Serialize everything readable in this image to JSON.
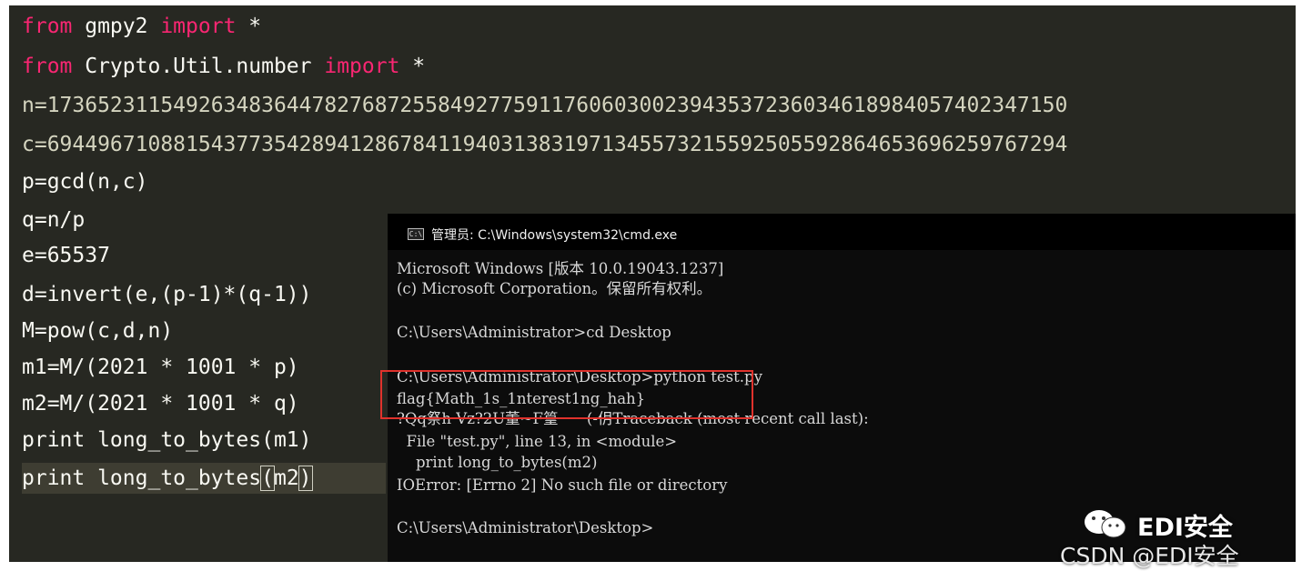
{
  "editor": {
    "lines": [
      {
        "a": "from",
        "b": " gmpy2 ",
        "c": "import",
        "d": " *"
      },
      {
        "a": "from",
        "b": " Crypto.Util.number ",
        "c": "import",
        "d": " *"
      },
      {
        "text": "n=173652311549263483644782768725584927759117606030023943537236034618984057402347150"
      },
      {
        "text": "c=694496710881543773542894128678411940313831971345573215592505592864653696259767294"
      },
      {
        "text": "p=gcd(n,c)"
      },
      {
        "text": "q=n/p"
      },
      {
        "text": "e=65537"
      },
      {
        "text": "d=invert(e,(p-1)*(q-1))"
      },
      {
        "text": "M=pow(c,d,n)"
      },
      {
        "text": "m1=M/(2021 * 1001 * p)"
      },
      {
        "text": "m2=M/(2021 * 1001 * q)"
      },
      {
        "text": "print long_to_bytes(m1)"
      },
      {
        "a": "print long_to_bytes",
        "b": "(",
        "c": "m2",
        "d": ")"
      }
    ]
  },
  "cmd": {
    "title": "管理员: C:\\Windows\\system32\\cmd.exe",
    "icon_label": "C:\\",
    "lines": [
      "Microsoft Windows [版本 10.0.19043.1237]",
      "(c) Microsoft Corporation。保留所有权利。",
      "",
      "C:\\Users\\Administrator>cd Desktop",
      "",
      "C:\\Users\\Administrator\\Desktop>python test.py",
      "flag{Math_1s_1nterest1ng_hah}",
      "?Qq祭h Vz?2U董~F篁      (-仴Traceback (most recent call last):",
      "  File \"test.py\", line 13, in <module>",
      "    print long_to_bytes(m2)",
      "IOError: [Errno 2] No such file or directory",
      "",
      "C:\\Users\\Administrator\\Desktop>"
    ]
  },
  "watermark": {
    "brand": "EDI安全",
    "credit": "CSDN @EDI安全",
    "icon": "wechat-icon"
  },
  "colors": {
    "editor_bg": "#272822",
    "keyword": "#f92672",
    "number": "#ae81ff",
    "highlight_border": "#e0322c"
  }
}
